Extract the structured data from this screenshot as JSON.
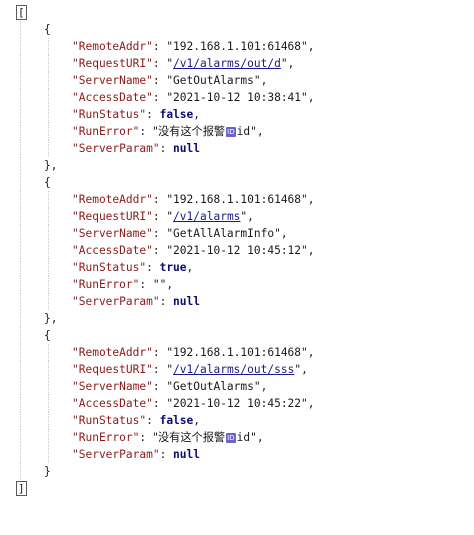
{
  "json_viewer": {
    "open_array": "[",
    "close_array": "]",
    "open_object": "{",
    "close_object": "}",
    "close_object_comma": "},",
    "records": [
      {
        "fields": [
          {
            "key": "\"RemoteAddr\"",
            "value": "\"192.168.1.101:61468\"",
            "kind": "str"
          },
          {
            "key": "\"RequestURI\"",
            "value": "\"/v1/alarms/out/d\"",
            "kind": "link"
          },
          {
            "key": "\"ServerName\"",
            "value": "\"GetOutAlarms\"",
            "kind": "str"
          },
          {
            "key": "\"AccessDate\"",
            "value": "\"2021-10-12 10:38:41\"",
            "kind": "str"
          },
          {
            "key": "\"RunStatus\"",
            "value": "false",
            "kind": "kw"
          },
          {
            "key": "\"RunError\"",
            "value_prefix": "\"没有这个报警",
            "badge": "ID",
            "value_suffix": "id\"",
            "kind": "err"
          },
          {
            "key": "\"ServerParam\"",
            "value": "null",
            "kind": "kw",
            "last": true
          }
        ]
      },
      {
        "fields": [
          {
            "key": "\"RemoteAddr\"",
            "value": "\"192.168.1.101:61468\"",
            "kind": "str"
          },
          {
            "key": "\"RequestURI\"",
            "value": "\"/v1/alarms\"",
            "kind": "link"
          },
          {
            "key": "\"ServerName\"",
            "value": "\"GetAllAlarmInfo\"",
            "kind": "str"
          },
          {
            "key": "\"AccessDate\"",
            "value": "\"2021-10-12 10:45:12\"",
            "kind": "str"
          },
          {
            "key": "\"RunStatus\"",
            "value": "true",
            "kind": "kw"
          },
          {
            "key": "\"RunError\"",
            "value": "\"\"",
            "kind": "str"
          },
          {
            "key": "\"ServerParam\"",
            "value": "null",
            "kind": "kw",
            "last": true
          }
        ]
      },
      {
        "fields": [
          {
            "key": "\"RemoteAddr\"",
            "value": "\"192.168.1.101:61468\"",
            "kind": "str"
          },
          {
            "key": "\"RequestURI\"",
            "value": "\"/v1/alarms/out/sss\"",
            "kind": "link"
          },
          {
            "key": "\"ServerName\"",
            "value": "\"GetOutAlarms\"",
            "kind": "str"
          },
          {
            "key": "\"AccessDate\"",
            "value": "\"2021-10-12 10:45:22\"",
            "kind": "str"
          },
          {
            "key": "\"RunStatus\"",
            "value": "false",
            "kind": "kw"
          },
          {
            "key": "\"RunError\"",
            "value_prefix": "\"没有这个报警",
            "badge": "ID",
            "value_suffix": "id\"",
            "kind": "err"
          },
          {
            "key": "\"ServerParam\"",
            "value": "null",
            "kind": "kw",
            "last": true
          }
        ]
      }
    ]
  }
}
